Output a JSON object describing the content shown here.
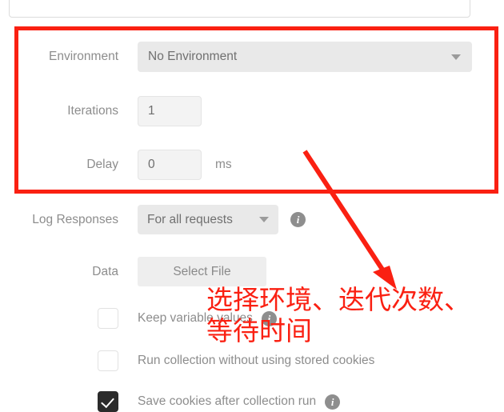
{
  "form": {
    "environment": {
      "label": "Environment",
      "value": "No Environment"
    },
    "iterations": {
      "label": "Iterations",
      "value": "1"
    },
    "delay": {
      "label": "Delay",
      "value": "0",
      "unit": "ms"
    },
    "log_responses": {
      "label": "Log Responses",
      "value": "For all requests",
      "info": "i"
    },
    "data": {
      "label": "Data",
      "button_label": "Select File"
    }
  },
  "checkboxes": [
    {
      "label": "Keep variable values",
      "checked": false,
      "info": "i"
    },
    {
      "label": "Run collection without using stored cookies",
      "checked": false,
      "info": ""
    },
    {
      "label": "Save cookies after collection run",
      "checked": true,
      "info": "i"
    }
  ],
  "annotation": {
    "color": "#fa2012",
    "text_line1": "选择环境、迭代次数、",
    "text_line2": "等待时间"
  }
}
